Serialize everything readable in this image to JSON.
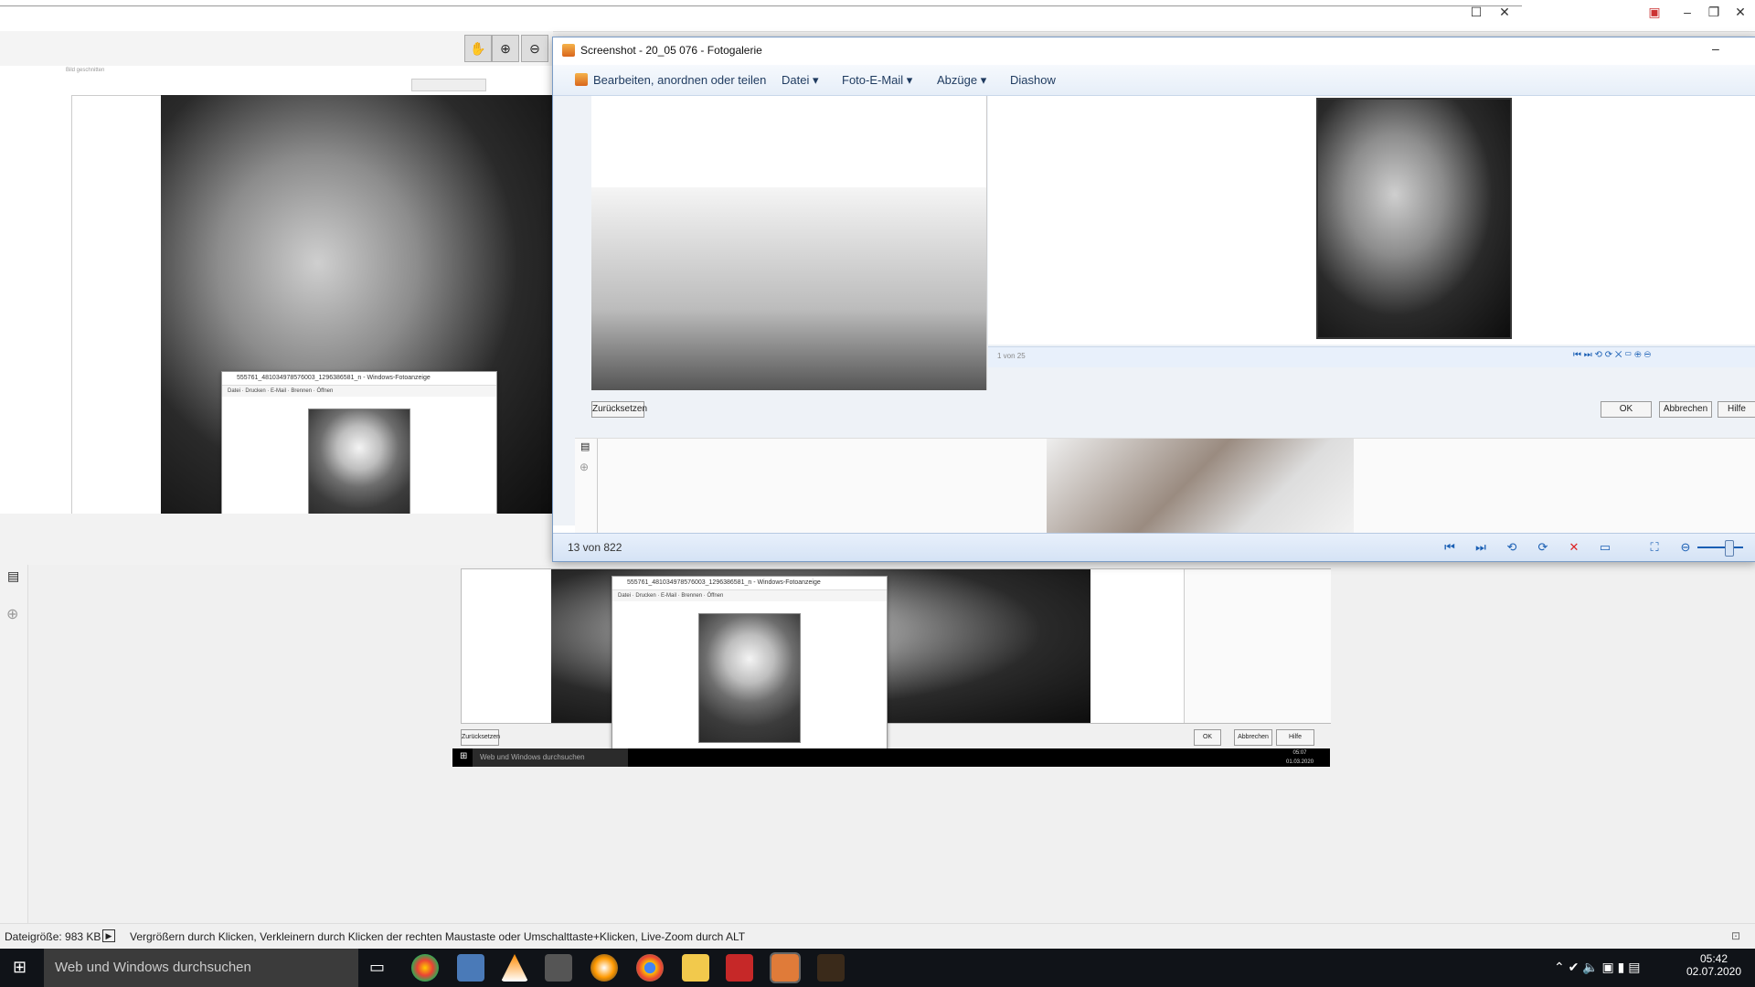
{
  "outer_window": {
    "ruler_hint": "Bild geschnitten",
    "controls": [
      "maximize",
      "close"
    ],
    "far_controls": [
      "minimize",
      "maximize",
      "close"
    ]
  },
  "zoom_toolbar": {
    "hand": "hand-tool",
    "zoom_in": "zoom-in",
    "zoom_out": "zoom-out"
  },
  "inner_photo_viewer": {
    "title": "555761_481034978576003_1296386581_n - Windows-Fotoanzeige",
    "menu": [
      "Datei",
      "Drucken",
      "E-Mail",
      "Brennen",
      "Öffnen"
    ]
  },
  "gallery": {
    "title": "Screenshot - 20_05 076 - Fotogalerie",
    "menu": {
      "edit": "Bearbeiten, anordnen oder teilen",
      "file": "Datei",
      "email": "Foto-E-Mail",
      "prints": "Abzüge",
      "slideshow": "Diashow"
    },
    "inner_counter": "1 von 25",
    "reset_button": "Zurücksetzen",
    "ok_button": "OK",
    "cancel_button": "Abbrechen",
    "help_button": "Hilfe",
    "counter": "13 von 822"
  },
  "lower_viewer": {
    "title": "555761_481034978576003_1296386581_n - Windows-Fotoanzeige",
    "menu": [
      "Datei",
      "Drucken",
      "E-Mail",
      "Brennen",
      "Öffnen"
    ],
    "reset_button": "Zurücksetzen",
    "ok_button": "OK",
    "cancel_button": "Abbrechen",
    "help_button": "Hilfe",
    "search_text": "Web und Windows durchsuchen",
    "clock": "05:07",
    "date": "01.03.2020"
  },
  "status": {
    "file_size": "Dateigröße: 983 KB",
    "hint": "Vergrößern durch Klicken, Verkleinern durch Klicken der rechten Maustaste oder Umschalttaste+Klicken, Live-Zoom durch ALT"
  },
  "taskbar": {
    "search_placeholder": "Web und Windows durchsuchen",
    "time": "05:42",
    "date": "02.07.2020"
  }
}
